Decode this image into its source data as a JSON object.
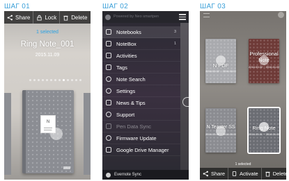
{
  "steps": [
    "ШАГ 01",
    "ШАГ 02",
    "ШАГ 03"
  ],
  "panel1": {
    "toolbar": {
      "share": "Share",
      "lock": "Lock",
      "delete": "Delete"
    },
    "selected_text": "1 selected",
    "note_title": "Ring Note_001",
    "note_date": "2015.11.09",
    "notebook_label": "N"
  },
  "panel2": {
    "powered_by": "Powered by Neo smartpen",
    "menu": [
      {
        "label": "Notebooks",
        "count": "3",
        "icon": "notebooks-icon",
        "active": true,
        "disabled": false
      },
      {
        "label": "NoteBox",
        "count": "1",
        "icon": "notebox-icon",
        "active": false,
        "disabled": false
      },
      {
        "label": "Activities",
        "count": "",
        "icon": "activities-icon",
        "active": false,
        "disabled": false
      },
      {
        "label": "Tags",
        "count": "",
        "icon": "tag-icon",
        "active": false,
        "disabled": false
      },
      {
        "label": "Note Search",
        "count": "",
        "icon": "search-icon",
        "active": false,
        "disabled": false
      },
      {
        "label": "Settings",
        "count": "",
        "icon": "gear-icon",
        "active": false,
        "disabled": false
      },
      {
        "label": "News & Tips",
        "count": "",
        "icon": "bell-icon",
        "active": false,
        "disabled": false
      },
      {
        "label": "Support",
        "count": "",
        "icon": "support-icon",
        "active": false,
        "disabled": false
      },
      {
        "label": "Pen Data Sync",
        "count": "",
        "icon": "download-icon",
        "active": false,
        "disabled": true
      },
      {
        "label": "Firmware Update",
        "count": "",
        "icon": "refresh-icon",
        "active": false,
        "disabled": false
      },
      {
        "label": "Google Drive Manager",
        "count": "",
        "icon": "drive-icon",
        "active": false,
        "disabled": false
      }
    ],
    "footer": "Evernote Sync"
  },
  "panel3": {
    "notebooks": [
      {
        "name": "",
        "date": "",
        "color": "#a9aaae"
      },
      {
        "name": "Professional Note",
        "date": "2016.03.02 ~ 2016.01.05",
        "color": "#6e3a37"
      },
      {
        "name": "N PDF",
        "date": "2016.03.02 ~ 2016.03.07",
        "color": "#8e8f94"
      },
      {
        "name": "",
        "date": "",
        "color": "#7c7d82"
      },
      {
        "name": "N Teaster SS",
        "date": "2016.03.02 ~ 2016.03.02",
        "color": "#8b8c91"
      },
      {
        "name": "Ring Note",
        "date": "2016.03.01 ~ 2016.01.02",
        "color": "#6b6d73"
      }
    ],
    "selected_text": "1 selected",
    "toolbar": {
      "share": "Share",
      "activate": "Activate",
      "delete": "Delete"
    }
  }
}
